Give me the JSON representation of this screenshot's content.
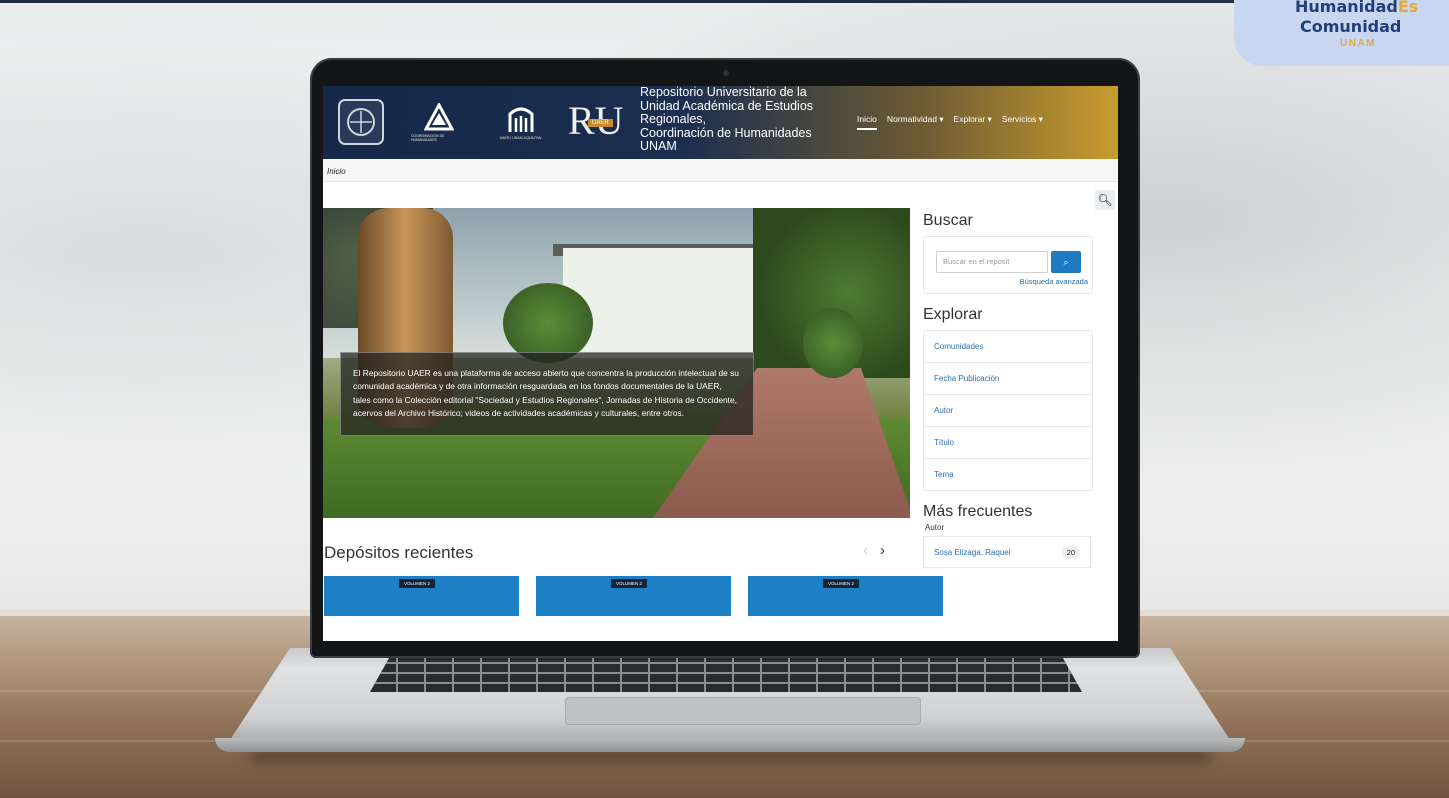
{
  "brand_badge": {
    "line1_main": "Humanidad",
    "line1_accent": "Es",
    "line2": "Comunidad",
    "line3": "UNAM"
  },
  "site": {
    "title_lines": [
      "Repositorio Universitario de la",
      "Unidad Académica de Estudios",
      "Regionales,",
      "Coordinación de Humanidades",
      "UNAM"
    ],
    "logos": [
      {
        "name": "unam-shield-icon"
      },
      {
        "name": "coordinacion-humanidades-icon",
        "caption": "COORDINACIÓN DE HUMANIDADES"
      },
      {
        "name": "uaer-building-icon",
        "caption": "UAER | UNAM JIQUILPAN"
      },
      {
        "name": "ru-uaer-logo",
        "text": "RU",
        "subtext": "UAER"
      }
    ]
  },
  "nav": {
    "items": [
      "Inicio",
      "Normatividad ▾",
      "Explorar ▾",
      "Servicios ▾"
    ],
    "active": "Inicio"
  },
  "breadcrumb": "Inicio",
  "hero": {
    "caption": "El Repositorio UAER es una plataforma de acceso abierto que concentra la producción intelectual de su comunidad académica y de otra información resguardada en los fondos documentales de la UAER, tales como la Colección editorial \"Sociedad y Estudios Regionales\", Jornadas de Historia de Occidente, acervos del Archivo Histórico; videos de actividades académicas y culturales, entre otros."
  },
  "sidebar": {
    "search": {
      "title": "Buscar",
      "placeholder": "Buscar en el reposit",
      "button_icon": "search-icon",
      "advanced_link": "Búsqueda avanzada"
    },
    "explore": {
      "title": "Explorar",
      "items": [
        "Comunidades",
        "Fecha Publicación",
        "Autor",
        "Título",
        "Tema"
      ]
    },
    "frequent": {
      "title": "Más frecuentes",
      "label": "Autor",
      "items": [
        {
          "name": "Sosa Elizaga, Raquel",
          "count": "20"
        }
      ]
    }
  },
  "recent": {
    "title": "Depósitos recientes",
    "cards": [
      {
        "tag": "VOLUMEN 2"
      },
      {
        "tag": "VOLUMEN 2"
      },
      {
        "tag": "VOLUMEN 2"
      }
    ]
  },
  "colors": {
    "header_start": "#16284a",
    "header_end": "#c99c2e",
    "link": "#2a6fae",
    "button": "#1f7ac2",
    "card": "#1e80c4"
  }
}
